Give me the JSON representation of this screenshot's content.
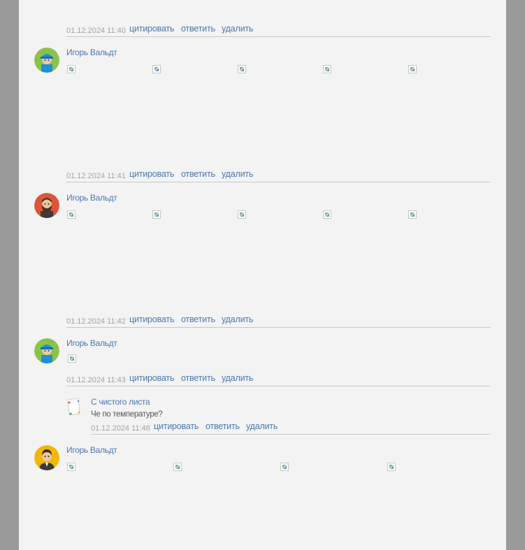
{
  "actions": {
    "quote": "цитировать",
    "reply": "ответить",
    "delete": "удалить"
  },
  "top_meta": {
    "date": "01.12.2024 11:40"
  },
  "comments": [
    {
      "author": "Игорь Вальдт",
      "date": "01.12.2024 11:41",
      "image_count": 5
    },
    {
      "author": "Игорь Вальдт",
      "date": "01.12.2024 11:42",
      "image_count": 5
    },
    {
      "author": "Игорь Вальдт",
      "date": "01.12.2024 11:43",
      "image_count": 1
    },
    {
      "author": "С чистого листа",
      "text": "Че по температуре?",
      "date": "01.12.2024 11:48"
    },
    {
      "author": "Игорь Вальдт",
      "image_count": 4
    }
  ],
  "colors": {
    "link": "#4a78b0",
    "date": "#a3a3a3",
    "divider": "#c9c9c9",
    "page_bg": "#f3f3f3"
  }
}
